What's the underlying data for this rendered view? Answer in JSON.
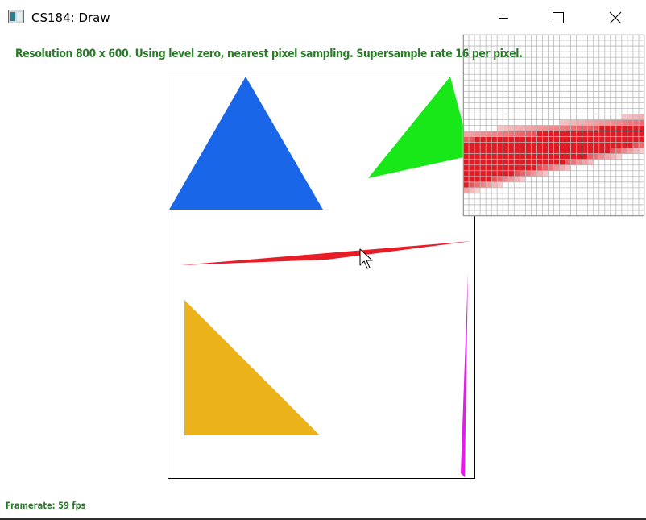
{
  "window": {
    "title": "CS184: Draw",
    "app_icon": "window-app-icon",
    "controls": [
      "minimize-icon",
      "maximize-icon",
      "close-icon"
    ]
  },
  "status": {
    "text": "Resolution 800 x 600. Using level zero, nearest pixel sampling. Supersample rate 16 per pixel.",
    "color": "#2a7a2a"
  },
  "footer": {
    "framerate": "Framerate: 59 fps"
  },
  "scene": {
    "shapes": [
      {
        "name": "blue-triangle",
        "color": "#1a66e8"
      },
      {
        "name": "green-triangle",
        "color": "#18e818"
      },
      {
        "name": "red-sliver-triangle",
        "color": "#e81c26"
      },
      {
        "name": "yellow-triangle",
        "color": "#ecb21c"
      },
      {
        "name": "magenta-sliver-triangle",
        "color": "#e41ce8"
      }
    ]
  },
  "zoom_inspector": {
    "grid_color": "#b9b9b9",
    "highlight_color": "#e01b24"
  },
  "cursor": "arrow-pointer-icon"
}
